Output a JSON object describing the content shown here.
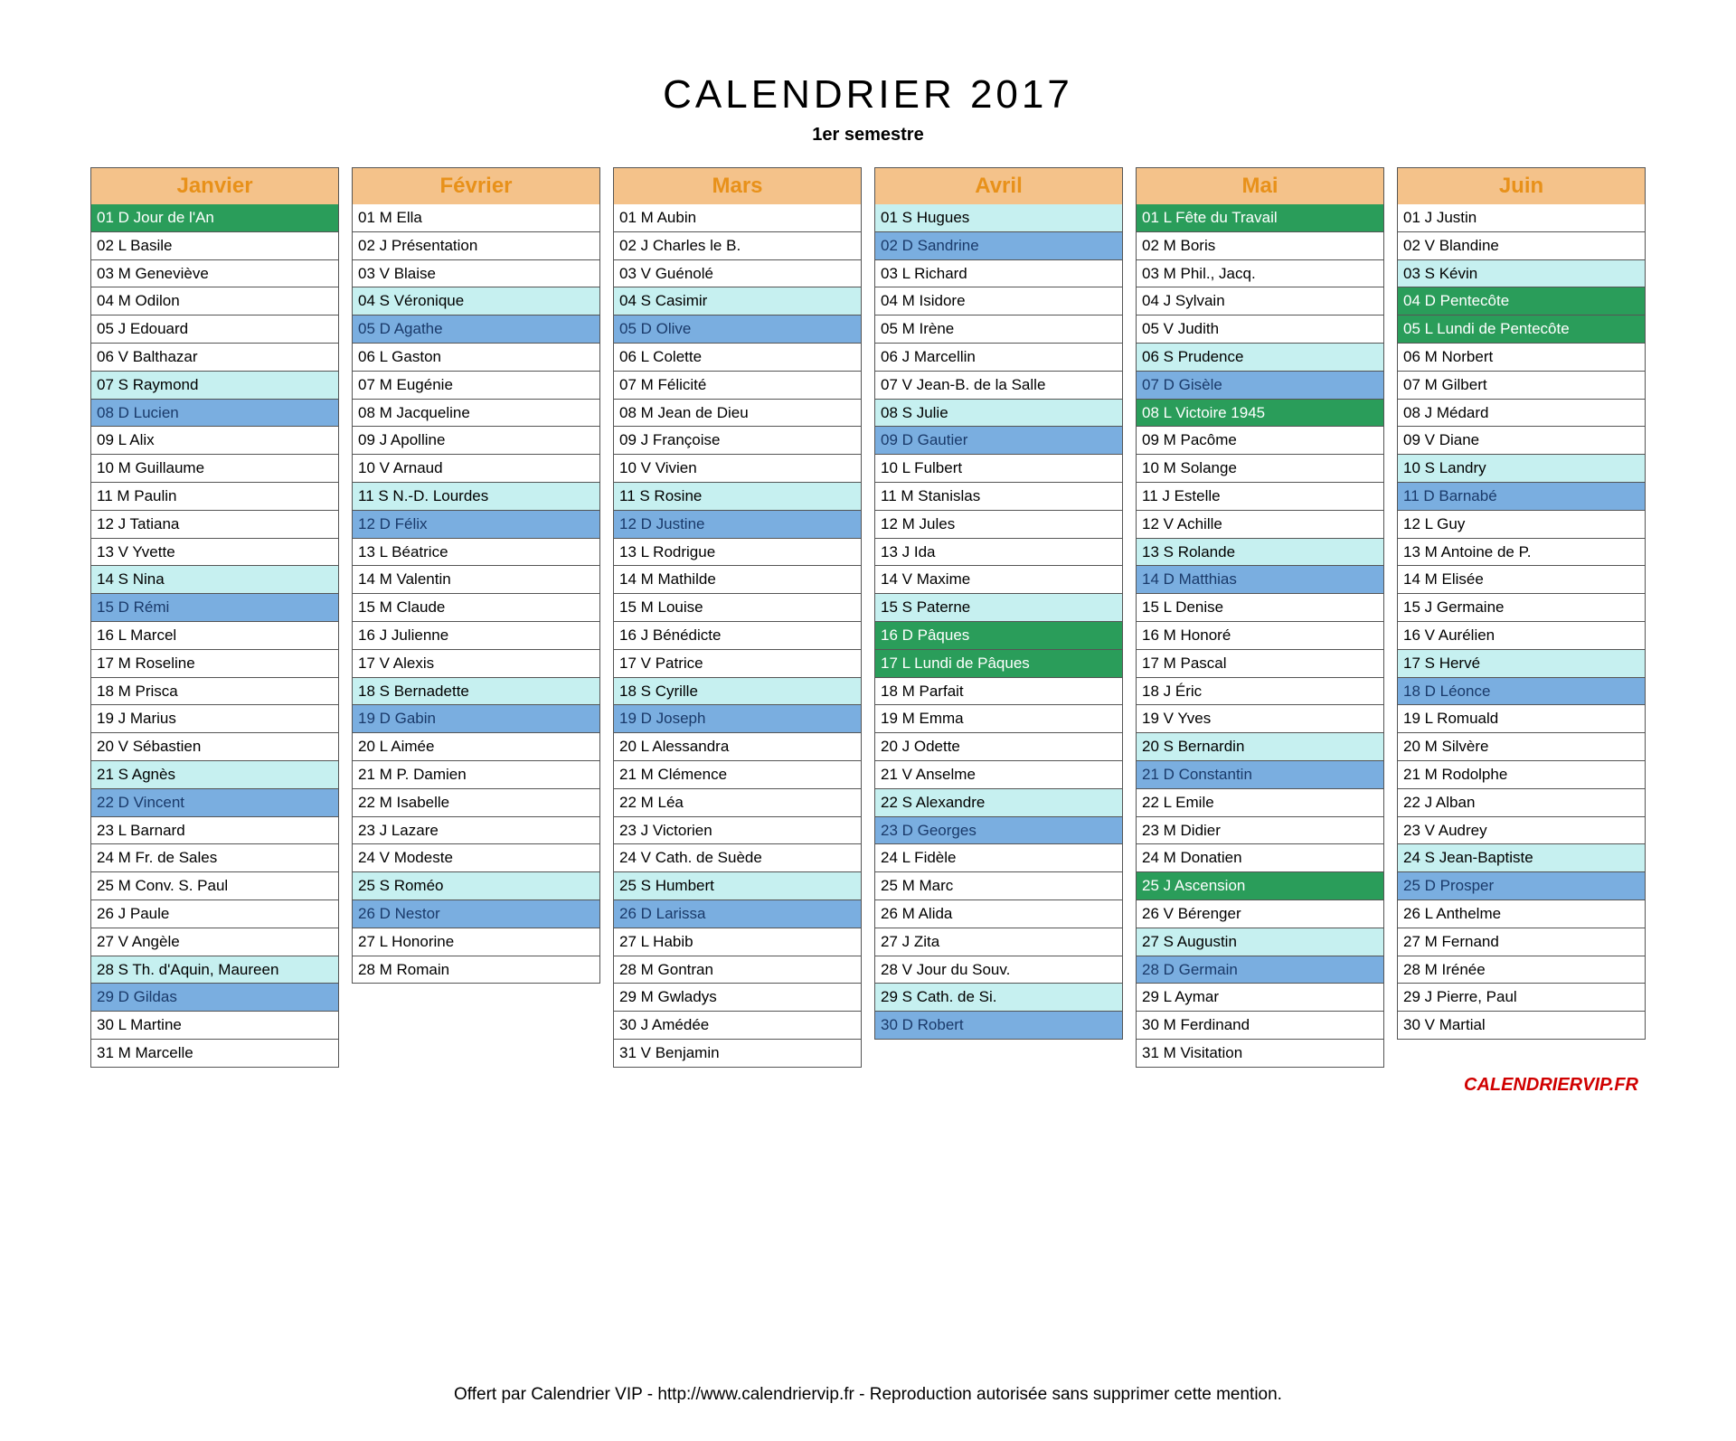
{
  "title": "CALENDRIER 2017",
  "subtitle": "1er semestre",
  "brand": "CALENDRIERVIP.FR",
  "footer": "Offert par Calendrier VIP - http://www.calendriervip.fr - Reproduction autorisée sans supprimer cette mention.",
  "months": [
    {
      "name": "Janvier",
      "days": [
        {
          "n": "01",
          "w": "D",
          "name": "Jour de l'An",
          "hl": "holiday"
        },
        {
          "n": "02",
          "w": "L",
          "name": "Basile"
        },
        {
          "n": "03",
          "w": "M",
          "name": "Geneviève"
        },
        {
          "n": "04",
          "w": "M",
          "name": "Odilon"
        },
        {
          "n": "05",
          "w": "J",
          "name": "Edouard"
        },
        {
          "n": "06",
          "w": "V",
          "name": "Balthazar"
        },
        {
          "n": "07",
          "w": "S",
          "name": "Raymond",
          "hl": "sat"
        },
        {
          "n": "08",
          "w": "D",
          "name": "Lucien",
          "hl": "sunday"
        },
        {
          "n": "09",
          "w": "L",
          "name": "Alix"
        },
        {
          "n": "10",
          "w": "M",
          "name": "Guillaume"
        },
        {
          "n": "11",
          "w": "M",
          "name": "Paulin"
        },
        {
          "n": "12",
          "w": "J",
          "name": "Tatiana"
        },
        {
          "n": "13",
          "w": "V",
          "name": "Yvette"
        },
        {
          "n": "14",
          "w": "S",
          "name": "Nina",
          "hl": "sat"
        },
        {
          "n": "15",
          "w": "D",
          "name": "Rémi",
          "hl": "sunday"
        },
        {
          "n": "16",
          "w": "L",
          "name": "Marcel"
        },
        {
          "n": "17",
          "w": "M",
          "name": "Roseline"
        },
        {
          "n": "18",
          "w": "M",
          "name": "Prisca"
        },
        {
          "n": "19",
          "w": "J",
          "name": "Marius"
        },
        {
          "n": "20",
          "w": "V",
          "name": "Sébastien"
        },
        {
          "n": "21",
          "w": "S",
          "name": "Agnès",
          "hl": "sat"
        },
        {
          "n": "22",
          "w": "D",
          "name": "Vincent",
          "hl": "sunday"
        },
        {
          "n": "23",
          "w": "L",
          "name": "Barnard"
        },
        {
          "n": "24",
          "w": "M",
          "name": "Fr. de Sales"
        },
        {
          "n": "25",
          "w": "M",
          "name": "Conv. S. Paul"
        },
        {
          "n": "26",
          "w": "J",
          "name": "Paule"
        },
        {
          "n": "27",
          "w": "V",
          "name": "Angèle"
        },
        {
          "n": "28",
          "w": "S",
          "name": "Th. d'Aquin, Maureen",
          "hl": "sat"
        },
        {
          "n": "29",
          "w": "D",
          "name": "Gildas",
          "hl": "sunday"
        },
        {
          "n": "30",
          "w": "L",
          "name": "Martine"
        },
        {
          "n": "31",
          "w": "M",
          "name": "Marcelle"
        }
      ]
    },
    {
      "name": "Février",
      "days": [
        {
          "n": "01",
          "w": "M",
          "name": "Ella"
        },
        {
          "n": "02",
          "w": "J",
          "name": "Présentation"
        },
        {
          "n": "03",
          "w": "V",
          "name": "Blaise"
        },
        {
          "n": "04",
          "w": "S",
          "name": "Véronique",
          "hl": "sat"
        },
        {
          "n": "05",
          "w": "D",
          "name": "Agathe",
          "hl": "sunday"
        },
        {
          "n": "06",
          "w": "L",
          "name": "Gaston"
        },
        {
          "n": "07",
          "w": "M",
          "name": "Eugénie"
        },
        {
          "n": "08",
          "w": "M",
          "name": "Jacqueline"
        },
        {
          "n": "09",
          "w": "J",
          "name": "Apolline"
        },
        {
          "n": "10",
          "w": "V",
          "name": "Arnaud"
        },
        {
          "n": "11",
          "w": "S",
          "name": "N.-D. Lourdes",
          "hl": "sat"
        },
        {
          "n": "12",
          "w": "D",
          "name": "Félix",
          "hl": "sunday"
        },
        {
          "n": "13",
          "w": "L",
          "name": "Béatrice"
        },
        {
          "n": "14",
          "w": "M",
          "name": "Valentin"
        },
        {
          "n": "15",
          "w": "M",
          "name": "Claude"
        },
        {
          "n": "16",
          "w": "J",
          "name": "Julienne"
        },
        {
          "n": "17",
          "w": "V",
          "name": "Alexis"
        },
        {
          "n": "18",
          "w": "S",
          "name": "Bernadette",
          "hl": "sat"
        },
        {
          "n": "19",
          "w": "D",
          "name": "Gabin",
          "hl": "sunday"
        },
        {
          "n": "20",
          "w": "L",
          "name": "Aimée"
        },
        {
          "n": "21",
          "w": "M",
          "name": "P. Damien"
        },
        {
          "n": "22",
          "w": "M",
          "name": "Isabelle"
        },
        {
          "n": "23",
          "w": "J",
          "name": "Lazare"
        },
        {
          "n": "24",
          "w": "V",
          "name": "Modeste"
        },
        {
          "n": "25",
          "w": "S",
          "name": "Roméo",
          "hl": "sat"
        },
        {
          "n": "26",
          "w": "D",
          "name": "Nestor",
          "hl": "sunday"
        },
        {
          "n": "27",
          "w": "L",
          "name": "Honorine"
        },
        {
          "n": "28",
          "w": "M",
          "name": "Romain"
        }
      ]
    },
    {
      "name": "Mars",
      "days": [
        {
          "n": "01",
          "w": "M",
          "name": "Aubin"
        },
        {
          "n": "02",
          "w": "J",
          "name": "Charles le B."
        },
        {
          "n": "03",
          "w": "V",
          "name": "Guénolé"
        },
        {
          "n": "04",
          "w": "S",
          "name": "Casimir",
          "hl": "sat"
        },
        {
          "n": "05",
          "w": "D",
          "name": "Olive",
          "hl": "sunday"
        },
        {
          "n": "06",
          "w": "L",
          "name": "Colette"
        },
        {
          "n": "07",
          "w": "M",
          "name": "Félicité"
        },
        {
          "n": "08",
          "w": "M",
          "name": "Jean de Dieu"
        },
        {
          "n": "09",
          "w": "J",
          "name": "Françoise"
        },
        {
          "n": "10",
          "w": "V",
          "name": "Vivien"
        },
        {
          "n": "11",
          "w": "S",
          "name": "Rosine",
          "hl": "sat"
        },
        {
          "n": "12",
          "w": "D",
          "name": "Justine",
          "hl": "sunday"
        },
        {
          "n": "13",
          "w": "L",
          "name": "Rodrigue"
        },
        {
          "n": "14",
          "w": "M",
          "name": "Mathilde"
        },
        {
          "n": "15",
          "w": "M",
          "name": "Louise"
        },
        {
          "n": "16",
          "w": "J",
          "name": "Bénédicte"
        },
        {
          "n": "17",
          "w": "V",
          "name": "Patrice"
        },
        {
          "n": "18",
          "w": "S",
          "name": "Cyrille",
          "hl": "sat"
        },
        {
          "n": "19",
          "w": "D",
          "name": "Joseph",
          "hl": "sunday"
        },
        {
          "n": "20",
          "w": "L",
          "name": "Alessandra"
        },
        {
          "n": "21",
          "w": "M",
          "name": "Clémence"
        },
        {
          "n": "22",
          "w": "M",
          "name": "Léa"
        },
        {
          "n": "23",
          "w": "J",
          "name": "Victorien"
        },
        {
          "n": "24",
          "w": "V",
          "name": "Cath. de Suède"
        },
        {
          "n": "25",
          "w": "S",
          "name": "Humbert",
          "hl": "sat"
        },
        {
          "n": "26",
          "w": "D",
          "name": "Larissa",
          "hl": "sunday"
        },
        {
          "n": "27",
          "w": "L",
          "name": "Habib"
        },
        {
          "n": "28",
          "w": "M",
          "name": "Gontran"
        },
        {
          "n": "29",
          "w": "M",
          "name": "Gwladys"
        },
        {
          "n": "30",
          "w": "J",
          "name": "Amédée"
        },
        {
          "n": "31",
          "w": "V",
          "name": "Benjamin"
        }
      ]
    },
    {
      "name": "Avril",
      "days": [
        {
          "n": "01",
          "w": "S",
          "name": "Hugues",
          "hl": "sat"
        },
        {
          "n": "02",
          "w": "D",
          "name": "Sandrine",
          "hl": "sunday"
        },
        {
          "n": "03",
          "w": "L",
          "name": "Richard"
        },
        {
          "n": "04",
          "w": "M",
          "name": "Isidore"
        },
        {
          "n": "05",
          "w": "M",
          "name": "Irène"
        },
        {
          "n": "06",
          "w": "J",
          "name": "Marcellin"
        },
        {
          "n": "07",
          "w": "V",
          "name": "Jean-B. de la Salle"
        },
        {
          "n": "08",
          "w": "S",
          "name": "Julie",
          "hl": "sat"
        },
        {
          "n": "09",
          "w": "D",
          "name": "Gautier",
          "hl": "sunday"
        },
        {
          "n": "10",
          "w": "L",
          "name": "Fulbert"
        },
        {
          "n": "11",
          "w": "M",
          "name": "Stanislas"
        },
        {
          "n": "12",
          "w": "M",
          "name": "Jules"
        },
        {
          "n": "13",
          "w": "J",
          "name": "Ida"
        },
        {
          "n": "14",
          "w": "V",
          "name": "Maxime"
        },
        {
          "n": "15",
          "w": "S",
          "name": "Paterne",
          "hl": "sat"
        },
        {
          "n": "16",
          "w": "D",
          "name": "Pâques",
          "hl": "holiday"
        },
        {
          "n": "17",
          "w": "L",
          "name": "Lundi de Pâques",
          "hl": "holiday"
        },
        {
          "n": "18",
          "w": "M",
          "name": "Parfait"
        },
        {
          "n": "19",
          "w": "M",
          "name": "Emma"
        },
        {
          "n": "20",
          "w": "J",
          "name": "Odette"
        },
        {
          "n": "21",
          "w": "V",
          "name": "Anselme"
        },
        {
          "n": "22",
          "w": "S",
          "name": "Alexandre",
          "hl": "sat"
        },
        {
          "n": "23",
          "w": "D",
          "name": "Georges",
          "hl": "sunday"
        },
        {
          "n": "24",
          "w": "L",
          "name": "Fidèle"
        },
        {
          "n": "25",
          "w": "M",
          "name": "Marc"
        },
        {
          "n": "26",
          "w": "M",
          "name": "Alida"
        },
        {
          "n": "27",
          "w": "J",
          "name": "Zita"
        },
        {
          "n": "28",
          "w": "V",
          "name": "Jour du Souv."
        },
        {
          "n": "29",
          "w": "S",
          "name": "Cath. de Si.",
          "hl": "sat"
        },
        {
          "n": "30",
          "w": "D",
          "name": "Robert",
          "hl": "sunday"
        }
      ]
    },
    {
      "name": "Mai",
      "days": [
        {
          "n": "01",
          "w": "L",
          "name": "Fête du Travail",
          "hl": "holiday"
        },
        {
          "n": "02",
          "w": "M",
          "name": "Boris"
        },
        {
          "n": "03",
          "w": "M",
          "name": "Phil., Jacq."
        },
        {
          "n": "04",
          "w": "J",
          "name": "Sylvain"
        },
        {
          "n": "05",
          "w": "V",
          "name": "Judith"
        },
        {
          "n": "06",
          "w": "S",
          "name": "Prudence",
          "hl": "sat"
        },
        {
          "n": "07",
          "w": "D",
          "name": "Gisèle",
          "hl": "sunday"
        },
        {
          "n": "08",
          "w": "L",
          "name": "Victoire 1945",
          "hl": "holiday"
        },
        {
          "n": "09",
          "w": "M",
          "name": "Pacôme"
        },
        {
          "n": "10",
          "w": "M",
          "name": "Solange"
        },
        {
          "n": "11",
          "w": "J",
          "name": "Estelle"
        },
        {
          "n": "12",
          "w": "V",
          "name": "Achille"
        },
        {
          "n": "13",
          "w": "S",
          "name": "Rolande",
          "hl": "sat"
        },
        {
          "n": "14",
          "w": "D",
          "name": "Matthias",
          "hl": "sunday"
        },
        {
          "n": "15",
          "w": "L",
          "name": "Denise"
        },
        {
          "n": "16",
          "w": "M",
          "name": "Honoré"
        },
        {
          "n": "17",
          "w": "M",
          "name": "Pascal"
        },
        {
          "n": "18",
          "w": "J",
          "name": "Éric"
        },
        {
          "n": "19",
          "w": "V",
          "name": "Yves"
        },
        {
          "n": "20",
          "w": "S",
          "name": "Bernardin",
          "hl": "sat"
        },
        {
          "n": "21",
          "w": "D",
          "name": "Constantin",
          "hl": "sunday"
        },
        {
          "n": "22",
          "w": "L",
          "name": "Emile"
        },
        {
          "n": "23",
          "w": "M",
          "name": "Didier"
        },
        {
          "n": "24",
          "w": "M",
          "name": "Donatien"
        },
        {
          "n": "25",
          "w": "J",
          "name": "Ascension",
          "hl": "holiday"
        },
        {
          "n": "26",
          "w": "V",
          "name": "Bérenger"
        },
        {
          "n": "27",
          "w": "S",
          "name": "Augustin",
          "hl": "sat"
        },
        {
          "n": "28",
          "w": "D",
          "name": "Germain",
          "hl": "sunday"
        },
        {
          "n": "29",
          "w": "L",
          "name": "Aymar"
        },
        {
          "n": "30",
          "w": "M",
          "name": "Ferdinand"
        },
        {
          "n": "31",
          "w": "M",
          "name": "Visitation"
        }
      ]
    },
    {
      "name": "Juin",
      "days": [
        {
          "n": "01",
          "w": "J",
          "name": "Justin"
        },
        {
          "n": "02",
          "w": "V",
          "name": "Blandine"
        },
        {
          "n": "03",
          "w": "S",
          "name": "Kévin",
          "hl": "sat"
        },
        {
          "n": "04",
          "w": "D",
          "name": "Pentecôte",
          "hl": "holiday"
        },
        {
          "n": "05",
          "w": "L",
          "name": "Lundi de Pentecôte",
          "hl": "holiday"
        },
        {
          "n": "06",
          "w": "M",
          "name": "Norbert"
        },
        {
          "n": "07",
          "w": "M",
          "name": "Gilbert"
        },
        {
          "n": "08",
          "w": "J",
          "name": "Médard"
        },
        {
          "n": "09",
          "w": "V",
          "name": "Diane"
        },
        {
          "n": "10",
          "w": "S",
          "name": "Landry",
          "hl": "sat"
        },
        {
          "n": "11",
          "w": "D",
          "name": "Barnabé",
          "hl": "sunday"
        },
        {
          "n": "12",
          "w": "L",
          "name": "Guy"
        },
        {
          "n": "13",
          "w": "M",
          "name": "Antoine de P."
        },
        {
          "n": "14",
          "w": "M",
          "name": "Elisée"
        },
        {
          "n": "15",
          "w": "J",
          "name": "Germaine"
        },
        {
          "n": "16",
          "w": "V",
          "name": "Aurélien"
        },
        {
          "n": "17",
          "w": "S",
          "name": "Hervé",
          "hl": "sat"
        },
        {
          "n": "18",
          "w": "D",
          "name": "Léonce",
          "hl": "sunday"
        },
        {
          "n": "19",
          "w": "L",
          "name": "Romuald"
        },
        {
          "n": "20",
          "w": "M",
          "name": "Silvère"
        },
        {
          "n": "21",
          "w": "M",
          "name": "Rodolphe"
        },
        {
          "n": "22",
          "w": "J",
          "name": "Alban"
        },
        {
          "n": "23",
          "w": "V",
          "name": "Audrey"
        },
        {
          "n": "24",
          "w": "S",
          "name": "Jean-Baptiste",
          "hl": "sat"
        },
        {
          "n": "25",
          "w": "D",
          "name": "Prosper",
          "hl": "sunday"
        },
        {
          "n": "26",
          "w": "L",
          "name": "Anthelme"
        },
        {
          "n": "27",
          "w": "M",
          "name": "Fernand"
        },
        {
          "n": "28",
          "w": "M",
          "name": "Irénée"
        },
        {
          "n": "29",
          "w": "J",
          "name": "Pierre, Paul"
        },
        {
          "n": "30",
          "w": "V",
          "name": "Martial"
        }
      ]
    }
  ]
}
